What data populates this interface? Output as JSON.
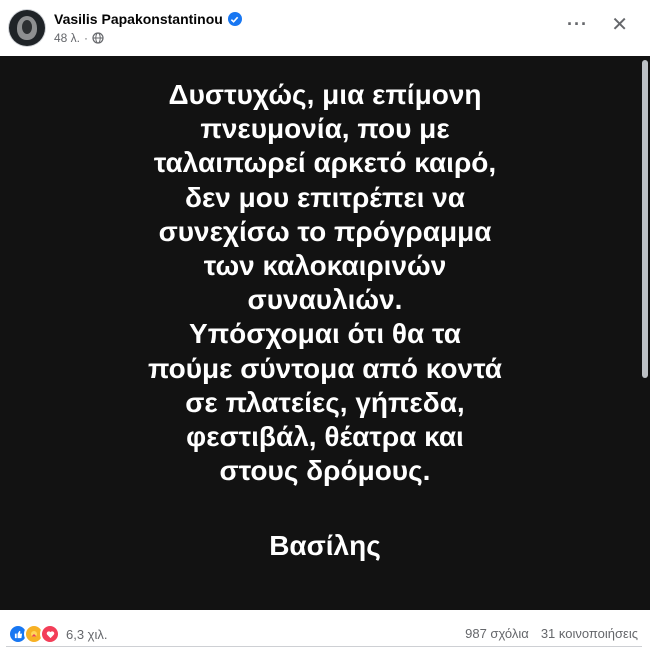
{
  "post": {
    "author": "Vasilis Papakonstantinou",
    "time": "48 λ.",
    "icons": {
      "verified": "verified-badge-icon",
      "audience": "globe-icon",
      "more": "more-options-icon",
      "close": "close-icon"
    },
    "text_lines": [
      "Δυστυχώς, μια επίμονη",
      "πνευμονία, που με",
      "ταλαιπωρεί αρκετό καιρό,",
      "δεν μου επιτρέπει να",
      "συνεχίσω το πρόγραμμα",
      "των καλοκαιρινών",
      "συναυλιών.",
      "Υπόσχομαι ότι θα τα",
      "πούμε σύντομα από κοντά",
      "σε πλατείες, γήπεδα,",
      "φεστιβάλ, θέατρα και",
      "στους δρόμους."
    ],
    "signature": "Βασίλης",
    "background_color": "#121212"
  },
  "stats": {
    "reaction_icons": [
      "like-reaction-icon",
      "care-reaction-icon",
      "love-reaction-icon"
    ],
    "reactions_count": "6,3 χιλ.",
    "comments": "987 σχόλια",
    "shares": "31 κοινοποιήσεις"
  },
  "colors": {
    "accent": "#1877f2",
    "secondary_text": "#65676b"
  }
}
